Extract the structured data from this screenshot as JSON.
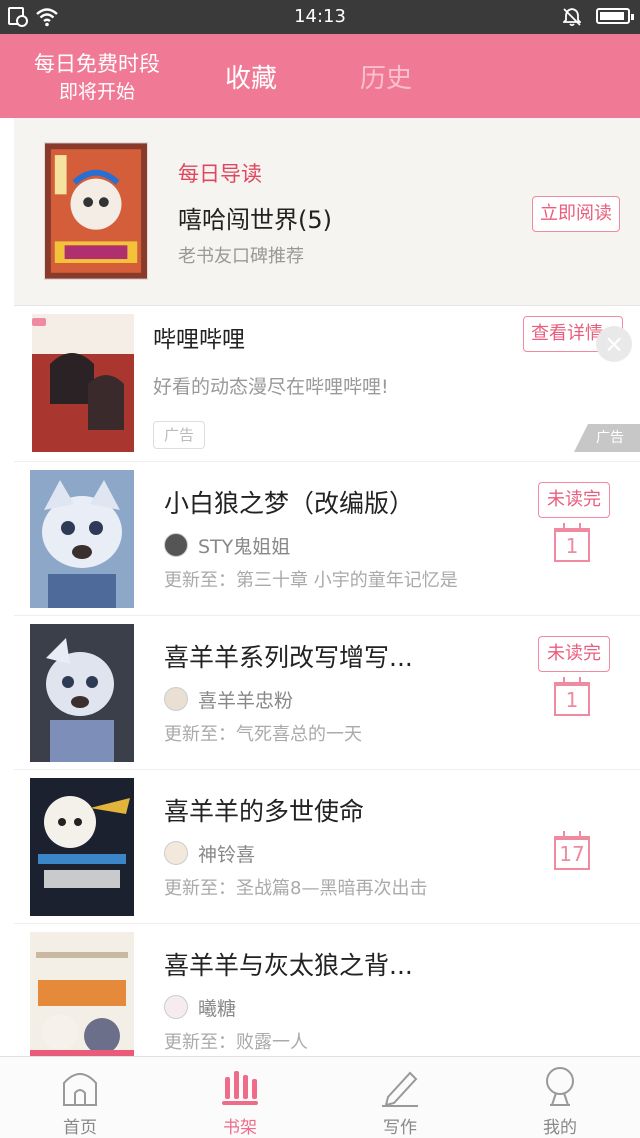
{
  "status_bar": {
    "time": "14:13"
  },
  "header": {
    "promo_line1": "每日免费时段",
    "promo_line2": "即将开始",
    "tabs": [
      {
        "label": "收藏",
        "active": true
      },
      {
        "label": "历史",
        "active": false
      }
    ]
  },
  "daily": {
    "tag": "每日导读",
    "title": "嘻哈闯世界(5)",
    "subtitle": "老书友口碑推荐",
    "button": "立即阅读"
  },
  "ad": {
    "title": "哔哩哔哩",
    "desc": "好看的动态漫尽在哔哩哔哩!",
    "badge": "广告",
    "button": "查看详情",
    "flag": "广告"
  },
  "books": [
    {
      "title": "小白狼之梦（改编版）",
      "author": "STY鬼姐姐",
      "update": "更新至：第三十章 小宇的童年记忆是",
      "unread": "未读完",
      "calendar": "1"
    },
    {
      "title": "喜羊羊系列改写增写...",
      "author": "喜羊羊忠粉",
      "update": "更新至：气死喜总的一天",
      "unread": "未读完",
      "calendar": "1"
    },
    {
      "title": "喜羊羊的多世使命",
      "author": "神铃喜",
      "update": "更新至：圣战篇8—黑暗再次出击",
      "unread": "",
      "calendar": "17"
    },
    {
      "title": "喜羊羊与灰太狼之背...",
      "author": "曦糖",
      "update": "更新至：败露一人",
      "unread": "",
      "calendar": ""
    }
  ],
  "bottom_nav": [
    {
      "label": "首页",
      "icon": "home-icon",
      "active": false
    },
    {
      "label": "书架",
      "icon": "bookshelf-icon",
      "active": true
    },
    {
      "label": "写作",
      "icon": "pen-icon",
      "active": false
    },
    {
      "label": "我的",
      "icon": "profile-icon",
      "active": false
    }
  ],
  "colors": {
    "accent": "#f07a95",
    "accent_text": "#ea5d7c",
    "daily_bg": "#f5f4f0"
  }
}
